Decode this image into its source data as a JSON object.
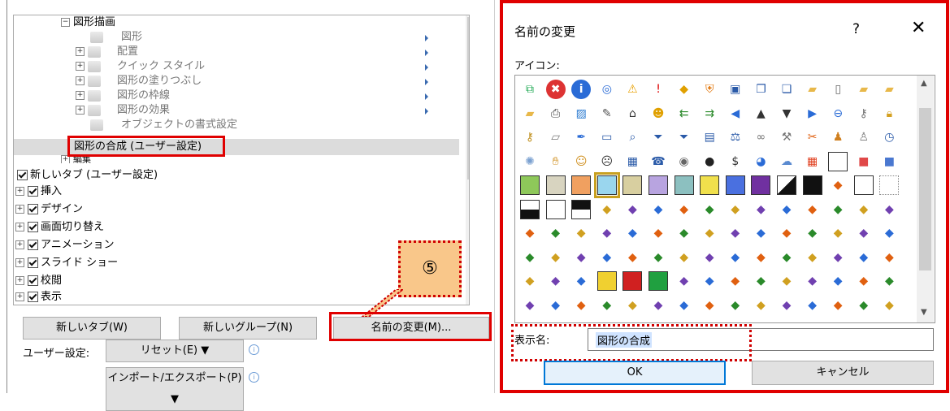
{
  "tree": {
    "items": [
      {
        "label": "図形描画",
        "state": "expanded"
      },
      {
        "label": "図形"
      },
      {
        "label": "配置"
      },
      {
        "label": "クイック スタイル"
      },
      {
        "label": "図形の塗りつぶし"
      },
      {
        "label": "図形の枠線"
      },
      {
        "label": "図形の効果"
      },
      {
        "label": "オブジェクトの書式設定"
      },
      {
        "label": "図形の合成 (ユーザー設定)",
        "selected": true
      },
      {
        "label": "編集"
      },
      {
        "label": "新しいタブ (ユーザー設定)"
      },
      {
        "label": "挿入"
      },
      {
        "label": "デザイン"
      },
      {
        "label": "画面切り替え"
      },
      {
        "label": "アニメーション"
      },
      {
        "label": "スライド ショー"
      },
      {
        "label": "校閲"
      },
      {
        "label": "表示"
      }
    ]
  },
  "callout": {
    "number": "⑤"
  },
  "buttons": {
    "new_tab": "新しいタブ(W)",
    "new_group": "新しいグループ(N)",
    "rename": "名前の変更(M)...",
    "reset": "リセット(E) ▼",
    "import_export": "インポート/エクスポート(P) ▼"
  },
  "user_settings_label": "ユーザー設定:",
  "dialog": {
    "title": "名前の変更",
    "help": "?",
    "close": "✕",
    "icons_label": "アイコン:",
    "display_name_label": "表示名:",
    "display_name_value": "図形の合成",
    "ok": "OK",
    "cancel": "キャンセル"
  },
  "icons": [
    [
      "org-chart",
      "error-x",
      "info",
      "circle-o",
      "warning",
      "exclamation",
      "diamond-warning",
      "shield",
      "save-disk",
      "window-copy",
      "window-paste",
      "folder",
      "blank-page",
      "new-folder",
      "folder-copy"
    ],
    [
      "open-folder",
      "printer",
      "picture",
      "edit-page",
      "home",
      "smiley-gear",
      "double-arrow-left",
      "double-arrow-right",
      "arrow-left",
      "arrow-up",
      "arrow-down",
      "arrow-right",
      "back-circle",
      "key-wrench",
      "lock"
    ],
    [
      "key",
      "eraser",
      "pen",
      "window",
      "magnifier",
      "filter",
      "filter-2",
      "book",
      "balance",
      "infinity",
      "tool",
      "scissors",
      "person",
      "people",
      "clock"
    ],
    [
      "sparkle",
      "hand",
      "smile",
      "sad",
      "calculator",
      "phone",
      "chat",
      "ball-8",
      "dollar",
      "eye",
      "cloud",
      "tiles",
      "white-square",
      "red-square",
      "blue-square"
    ],
    [
      "green-square",
      "beige-square",
      "orange-square",
      "cyan-square-selected",
      "tan-square",
      "lavender-square",
      "teal-square",
      "yellow-square",
      "blue-square-2",
      "purple-square",
      "half-square",
      "black-square",
      "window-square",
      "outline-square",
      "dotted-square"
    ],
    [
      "bottom-half",
      "plain-box",
      "top-half",
      "checker",
      "forward-circle",
      "bar-chart",
      "drop",
      "area-chart",
      "funnel",
      "pie-chart",
      "donut",
      "cylinder",
      "cube",
      "box-3d",
      "snowflake"
    ],
    [
      "gradient",
      "box-outline",
      "contact",
      "chip",
      "brush-pen",
      "sparkle-pen",
      "text-a",
      "text-a-bold",
      "x-mark",
      "check",
      "ruler-pen",
      "refresh",
      "bracket",
      "pi",
      "highlighter"
    ],
    [
      "binoculars",
      "paintbrush",
      "list",
      "play",
      "anchor",
      "gear-box",
      "lasso",
      "copy",
      "clipboard",
      "book-open",
      "pencil",
      "shape-a",
      "heart",
      "bell",
      "envelope"
    ],
    [
      "list-box",
      "list-box-2",
      "checklist",
      "yellow-box",
      "red-box",
      "green-box",
      "ie",
      "house",
      "crosshair",
      "window-2",
      "note",
      "globe",
      "picture-2",
      "cube-2",
      "clipboard-check"
    ],
    [
      "cube-3d",
      "grid",
      "window-3",
      "copy-2",
      "award",
      "grid-2",
      "cursor",
      "spell",
      "abc",
      "clock-2",
      "window-4",
      "hourglass",
      "pen-underline",
      "align",
      "eraser-2"
    ]
  ]
}
